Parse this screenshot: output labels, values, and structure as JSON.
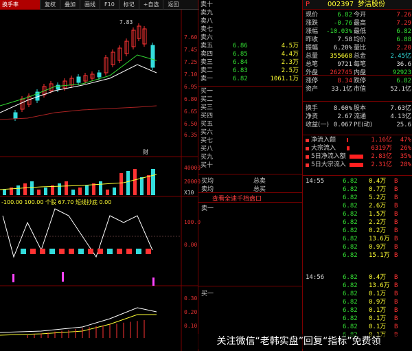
{
  "toolbar": {
    "logo": "换手率",
    "buttons": [
      "复权",
      "叠加",
      "画线",
      "F10",
      "标记",
      "+自选",
      "返回"
    ]
  },
  "chart": {
    "price_labels": [
      "7.60",
      "7.45",
      "7.25",
      "7.10",
      "6.95",
      "6.80",
      "6.65",
      "6.50",
      "6.35"
    ],
    "high_mark": "7.83",
    "low_mark": "5.79",
    "vol_labels": [
      "40000",
      "20000",
      "X10"
    ],
    "indicator_header": "-100.00  100.00 个股 67.70 短线抄底 0.00",
    "ind_labels": [
      "100.0",
      "0.00"
    ],
    "macd_labels": [
      "0.30",
      "0.20",
      "0.10"
    ],
    "cai_label": "财"
  },
  "book": {
    "asks": [
      {
        "label": "卖十",
        "price": "",
        "vol": ""
      },
      {
        "label": "卖九",
        "price": "",
        "vol": ""
      },
      {
        "label": "卖八",
        "price": "",
        "vol": ""
      },
      {
        "label": "卖七",
        "price": "",
        "vol": ""
      },
      {
        "label": "卖六",
        "price": "",
        "vol": ""
      },
      {
        "label": "卖五",
        "price": "6.86",
        "vol": "4.5万"
      },
      {
        "label": "卖四",
        "price": "6.85",
        "vol": "4.4万"
      },
      {
        "label": "卖三",
        "price": "6.84",
        "vol": "2.3万"
      },
      {
        "label": "卖二",
        "price": "6.83",
        "vol": "2.5万"
      },
      {
        "label": "卖一",
        "price": "6.82",
        "vol": "1061.1万"
      }
    ],
    "bids": [
      "买一",
      "买二",
      "买三",
      "买四",
      "买五",
      "买六",
      "买七",
      "买八",
      "买九",
      "买十"
    ],
    "avg_buy": "买均",
    "total_sell": "总卖",
    "avg_sell": "卖均",
    "total_buy": "总买",
    "view_queue": "查看全速千档盘口",
    "sell1_queue": "卖一",
    "buy1_queue": "买一"
  },
  "quote": {
    "p_flag": "P",
    "code": "002397",
    "name": "梦洁股份",
    "rows": [
      {
        "l": "现价",
        "v": "6.82",
        "vc": "grn",
        "l2": "今开",
        "v2": "7.26",
        "v2c": "red"
      },
      {
        "l": "涨跌",
        "v": "-0.76",
        "vc": "grn",
        "l2": "最高",
        "v2": "7.29",
        "v2c": "red"
      },
      {
        "l": "涨幅",
        "v": "-10.03%",
        "vc": "grn",
        "l2": "最低",
        "v2": "6.82",
        "v2c": "grn"
      },
      {
        "l": "昨收",
        "v": "7.58",
        "vc": "wht",
        "l2": "均价",
        "v2": "6.88",
        "v2c": "grn"
      },
      {
        "l": "振幅",
        "v": "6.20%",
        "vc": "wht",
        "l2": "量比",
        "v2": "2.20",
        "v2c": "red"
      },
      {
        "l": "总量",
        "v": "355668",
        "vc": "yel",
        "l2": "总金",
        "v2": "2.45亿",
        "v2c": "cyn"
      },
      {
        "l": "总笔",
        "v": "9721",
        "vc": "wht",
        "l2": "每笔",
        "v2": "36.6",
        "v2c": "wht"
      },
      {
        "l": "外盘",
        "v": "262745",
        "vc": "red",
        "l2": "内盘",
        "v2": "92923",
        "v2c": "grn"
      },
      {
        "l": "涨停",
        "v": "8.34",
        "vc": "red",
        "l2": "跌停",
        "v2": "6.82",
        "v2c": "grn"
      },
      {
        "l": "资产",
        "v": "33.1亿",
        "vc": "wht",
        "l2": "市值",
        "v2": "52.1亿",
        "v2c": "wht"
      },
      {
        "l": "换手",
        "v": "8.60%",
        "vc": "wht",
        "l2": "股本",
        "v2": "7.63亿",
        "v2c": "wht"
      },
      {
        "l": "净资",
        "v": "2.67",
        "vc": "wht",
        "l2": "流通",
        "v2": "4.13亿",
        "v2c": "wht"
      },
      {
        "l": "收益(一)",
        "v": "0.067",
        "vc": "wht",
        "l2": "PE(动)",
        "v2": "25.6",
        "v2c": "wht"
      }
    ],
    "flows": [
      {
        "l": "净流入额",
        "v": "1.16亿",
        "p": "47%",
        "fill": 0.05
      },
      {
        "l": "大宗流入",
        "v": "6319万",
        "p": "26%",
        "fill": 0.1
      },
      {
        "l": "5日净流入额",
        "v": "2.83亿",
        "p": "35%",
        "fill": 0.5
      },
      {
        "l": "5日大宗流入",
        "v": "2.31亿",
        "p": "28%",
        "fill": 0.5
      }
    ],
    "ticks_a": {
      "time": "14:55",
      "rows": [
        {
          "t": "14:55",
          "p": "6.82",
          "v": "0.4万",
          "s": "B"
        },
        {
          "t": "",
          "p": "6.82",
          "v": "0.7万",
          "s": "B"
        },
        {
          "t": "",
          "p": "6.82",
          "v": "5.2万",
          "s": "B"
        },
        {
          "t": "",
          "p": "6.82",
          "v": "2.6万",
          "s": "B"
        },
        {
          "t": "",
          "p": "6.82",
          "v": "1.5万",
          "s": "B"
        },
        {
          "t": "",
          "p": "6.82",
          "v": "2.2万",
          "s": "B"
        },
        {
          "t": "",
          "p": "6.82",
          "v": "0.2万",
          "s": "B"
        },
        {
          "t": "",
          "p": "6.82",
          "v": "13.6万",
          "s": "B"
        },
        {
          "t": "",
          "p": "6.82",
          "v": "0.9万",
          "s": "B"
        },
        {
          "t": "",
          "p": "6.82",
          "v": "15.1万",
          "s": "B"
        }
      ]
    },
    "ticks_b": {
      "rows": [
        {
          "t": "14:56",
          "p": "6.82",
          "v": "0.4万",
          "s": "B"
        },
        {
          "t": "",
          "p": "6.82",
          "v": "13.6万",
          "s": "B"
        },
        {
          "t": "",
          "p": "6.82",
          "v": "0.1万",
          "s": "B"
        },
        {
          "t": "",
          "p": "6.82",
          "v": "0.9万",
          "s": "B"
        },
        {
          "t": "",
          "p": "6.82",
          "v": "0.1万",
          "s": "B"
        },
        {
          "t": "",
          "p": "6.82",
          "v": "0.1万",
          "s": "B"
        },
        {
          "t": "",
          "p": "6.82",
          "v": "0.1万",
          "s": "B"
        },
        {
          "t": "",
          "p": "6.82",
          "v": "0.1万",
          "s": "B"
        }
      ]
    }
  },
  "footer": "关注微信“老韩实盘”回复“指标”免费领",
  "colors": {
    "up": "#ff3333",
    "down": "#33e033",
    "vol": "#ffff33",
    "bg": "#000000",
    "frame": "#7a0000"
  }
}
